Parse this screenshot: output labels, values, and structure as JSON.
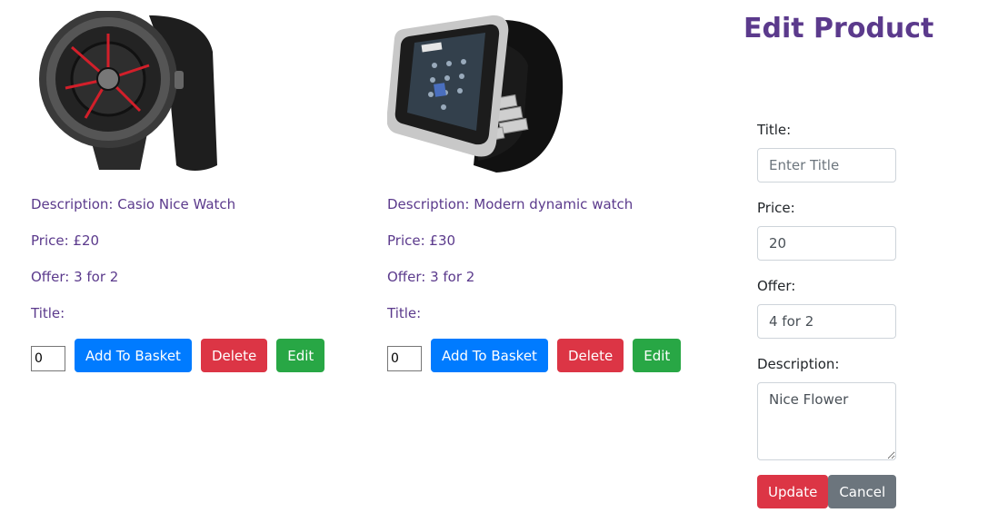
{
  "products": [
    {
      "description": "Description: Casio Nice Watch",
      "price": "Price: £20",
      "offer": "Offer: 3 for 2",
      "title": "Title:",
      "quantity": "0",
      "add_label": "Add To Basket",
      "delete_label": "Delete",
      "edit_label": "Edit"
    },
    {
      "description": "Description: Modern dynamic watch",
      "price": "Price: £30",
      "offer": "Offer: 3 for 2",
      "title": "Title:",
      "quantity": "0",
      "add_label": "Add To Basket",
      "delete_label": "Delete",
      "edit_label": "Edit"
    }
  ],
  "edit_form": {
    "heading": "Edit Product",
    "title_label": "Title:",
    "title_placeholder": "Enter Title",
    "price_label": "Price:",
    "price_value": "20",
    "offer_label": "Offer:",
    "offer_value": "4 for 2",
    "description_label": "Description:",
    "description_value": "Nice Flower",
    "update_label": "Update",
    "cancel_label": "Cancel"
  },
  "colors": {
    "text_purple": "#5b3a8c",
    "primary": "#007bff",
    "danger": "#dc3545",
    "success": "#28a745",
    "secondary": "#6c757d"
  }
}
